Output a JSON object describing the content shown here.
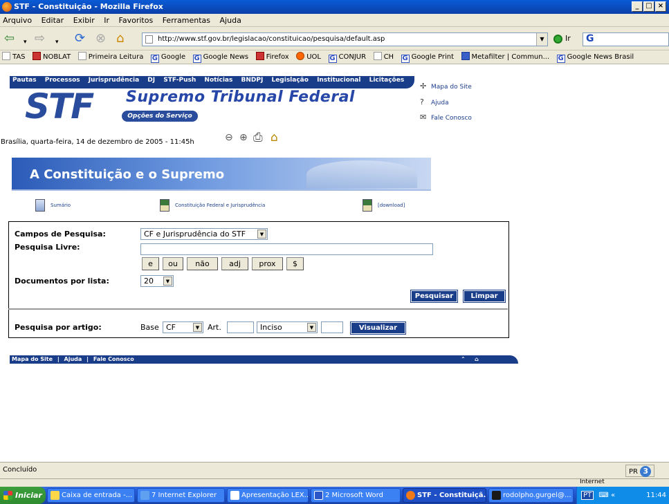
{
  "window": {
    "title": "STF - Constituição - Mozilla Firefox",
    "minimize": "_",
    "maximize": "□",
    "close": "×"
  },
  "menu": [
    "Arquivo",
    "Editar",
    "Exibir",
    "Ir",
    "Favoritos",
    "Ferramentas",
    "Ajuda"
  ],
  "nav": {
    "url": "http://www.stf.gov.br/legislacao/constituicao/pesquisa/default.asp",
    "go_label": "Ir",
    "search_logo": "G"
  },
  "bookmarks": [
    {
      "label": "TAS",
      "icon": "page-icon"
    },
    {
      "label": "NOBLAT",
      "icon": "red-icon"
    },
    {
      "label": "Primeira Leitura",
      "icon": "page-icon"
    },
    {
      "label": "Google",
      "icon": "google-icon"
    },
    {
      "label": "Google News",
      "icon": "google-icon"
    },
    {
      "label": "Firefox",
      "icon": "firefox-icon"
    },
    {
      "label": "UOL",
      "icon": "uol-icon"
    },
    {
      "label": "CONJUR",
      "icon": "google-icon"
    },
    {
      "label": "CH",
      "icon": "page-icon"
    },
    {
      "label": "Google Print",
      "icon": "google-icon"
    },
    {
      "label": "Metafilter | Commun...",
      "icon": "metafilter-icon"
    },
    {
      "label": "Google News Brasil",
      "icon": "google-icon"
    }
  ],
  "site": {
    "topnav": [
      "Pautas",
      "Processos",
      "Jurisprudência",
      "DJ",
      "STF-Push",
      "Notícias",
      "BNDPJ",
      "Legislação",
      "Institucional",
      "Licitações"
    ],
    "logo": "STF",
    "name": "Supremo Tribunal Federal",
    "opcoes": "Opções do Serviço",
    "sidelinks": [
      "Mapa do Site",
      "Ajuda",
      "Fale Conosco"
    ],
    "date": "Brasília, quarta-feira, 14 de dezembro de 2005 - 11:45h",
    "banner_title": "A Constituição e o Supremo",
    "sublinks": [
      "Sumário",
      "Constituição Federal e Jurisprudência",
      "[download]"
    ]
  },
  "form": {
    "campos_label": "Campos de Pesquisa:",
    "campos_value": "CF e Jurisprudência do STF",
    "livre_label": "Pesquisa Livre:",
    "livre_value": "",
    "operators": [
      "e",
      "ou",
      "não",
      "adj",
      "prox",
      "$"
    ],
    "docs_label": "Documentos por lista:",
    "docs_value": "20",
    "pesquisar": "Pesquisar",
    "limpar": "Limpar",
    "artigo_label": "Pesquisa por artigo:",
    "base_label": "Base",
    "base_value": "CF",
    "art_label": "Art.",
    "inciso_value": "Inciso",
    "visualizar": "Visualizar"
  },
  "footer": {
    "links": [
      "Mapa do Site",
      "|",
      "Ajuda",
      "|",
      "Fale Conosco"
    ]
  },
  "status": {
    "text": "Concluído",
    "pr_label": "PR",
    "pr_value": "3",
    "zone": "Internet"
  },
  "taskbar": {
    "start": "Iniciar",
    "tasks": [
      "Caixa de entrada -...",
      "7 Internet Explorer",
      "Apresentação LEX...",
      "2 Microsoft Word",
      "STF - Constituiçã...",
      "rodolpho.gurgel@..."
    ],
    "lang": "PT",
    "clock": "11:44"
  }
}
